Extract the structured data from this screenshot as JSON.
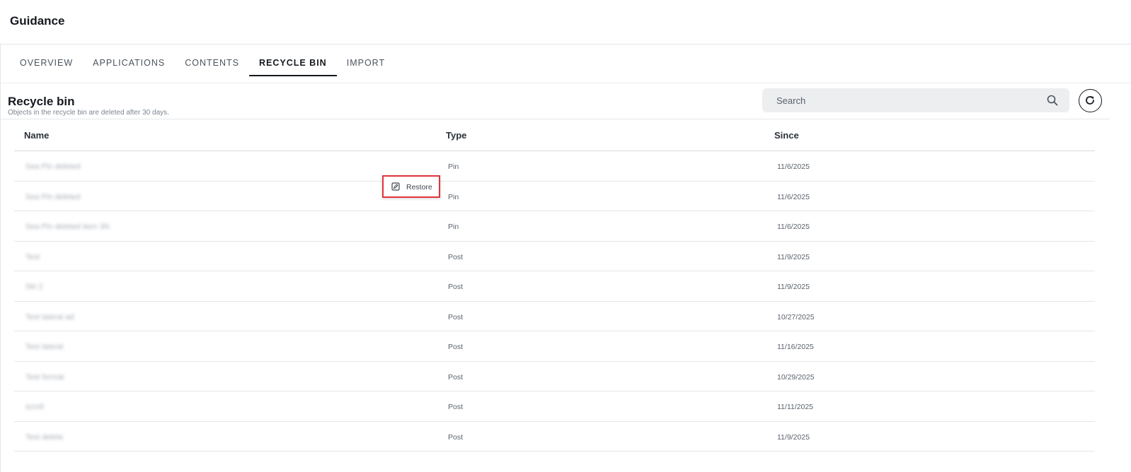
{
  "app": {
    "title": "Guidance"
  },
  "tabs": [
    {
      "label": "OVERVIEW",
      "active": false
    },
    {
      "label": "APPLICATIONS",
      "active": false
    },
    {
      "label": "CONTENTS",
      "active": false
    },
    {
      "label": "RECYCLE BIN",
      "active": true
    },
    {
      "label": "IMPORT",
      "active": false
    }
  ],
  "page": {
    "title": "Recycle bin",
    "subtitle": "Objects in the recycle bin are deleted after 30 days."
  },
  "search": {
    "placeholder": "Search",
    "value": "",
    "icon": "search-icon"
  },
  "refresh": {
    "icon": "refresh-icon"
  },
  "table": {
    "columns": [
      "Name",
      "Type",
      "Since"
    ],
    "rows": [
      {
        "name": "Sea Pin deleted",
        "type": "Pin",
        "since": "11/6/2025"
      },
      {
        "name": "Sea Pin deleted",
        "type": "Pin",
        "since": "11/6/2025"
      },
      {
        "name": "Sea Pin deleted item 3N",
        "type": "Pin",
        "since": "11/6/2025"
      },
      {
        "name": "Test",
        "type": "Post",
        "since": "11/9/2025"
      },
      {
        "name": "Ski 2",
        "type": "Post",
        "since": "11/9/2025"
      },
      {
        "name": "Test lateral ad",
        "type": "Post",
        "since": "10/27/2025"
      },
      {
        "name": "Test lateral",
        "type": "Post",
        "since": "11/16/2025"
      },
      {
        "name": "Test format",
        "type": "Post",
        "since": "10/29/2025"
      },
      {
        "name": "scroll",
        "type": "Post",
        "since": "11/11/2025"
      },
      {
        "name": "Test delete",
        "type": "Post",
        "since": "11/9/2025"
      }
    ]
  },
  "restore": {
    "label": "Restore",
    "icon": "restore-icon"
  },
  "colors": {
    "accent": "#15191e",
    "highlight": "#e0353b",
    "search_bg": "#eceef0"
  }
}
